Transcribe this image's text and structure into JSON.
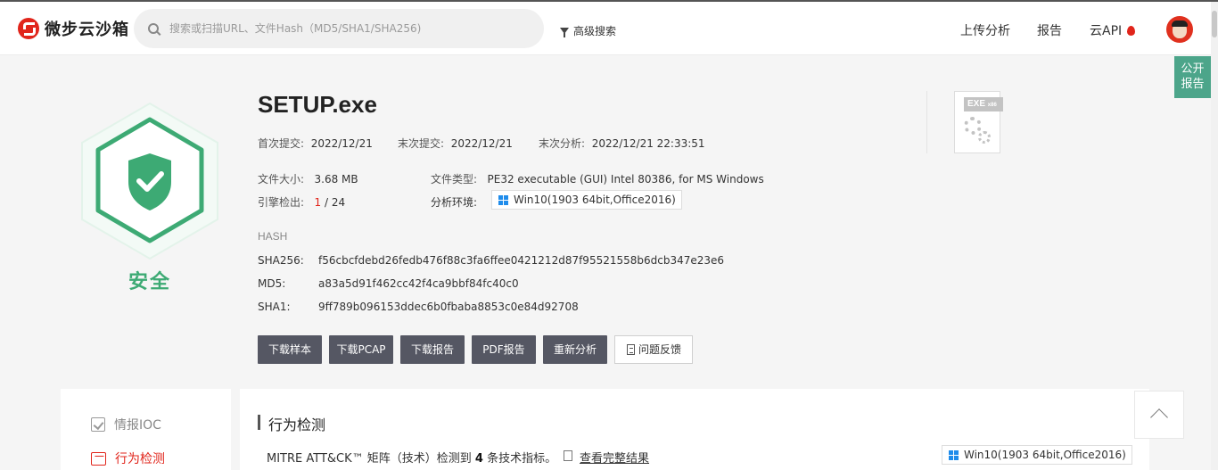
{
  "header": {
    "logo_text": "微步云沙箱",
    "search_placeholder": "搜索或扫描URL、文件Hash（MD5/SHA1/SHA256)",
    "advanced_search": "高级搜索",
    "nav_upload": "上传分析",
    "nav_report": "报告",
    "nav_api": "云API"
  },
  "side_tab": {
    "line1": "公开",
    "line2": "报告"
  },
  "verdict": {
    "label": "安全",
    "color": "#3daa74"
  },
  "file": {
    "name": "SETUP.exe",
    "first_submit_label": "首次提交:",
    "first_submit": "2022/12/21",
    "last_submit_label": "末次提交:",
    "last_submit": "2022/12/21",
    "last_analysis_label": "末次分析:",
    "last_analysis": "2022/12/21 22:33:51",
    "size_label": "文件大小:",
    "size": "3.68 MB",
    "type_label": "文件类型:",
    "type": "PE32 executable (GUI) Intel 80386, for MS Windows",
    "engine_label": "引擎检出:",
    "engine_hits": "1",
    "engine_total": "/ 24",
    "env_label": "分析环境:",
    "env": "Win10(1903 64bit,Office2016)",
    "icon_label": "EXE",
    "icon_sub": "x86"
  },
  "hash": {
    "heading": "HASH",
    "sha256_label": "SHA256:",
    "sha256": "f56cbcfdebd26fedb476f88c3fa6ffee0421212d87f95521558b6dcb347e23e6",
    "md5_label": "MD5:",
    "md5": "a83a5d91f462cc42f4ca9bbf84fc40c0",
    "sha1_label": "SHA1:",
    "sha1": "9ff789b096153ddec6b0fbaba8853c0e84d92708"
  },
  "actions": {
    "download_sample": "下载样本",
    "download_pcap": "下载PCAP",
    "download_report": "下载报告",
    "pdf_report": "PDF报告",
    "reanalyze": "重新分析",
    "feedback": "问题反馈"
  },
  "left_nav": {
    "ioc": "情报IOC",
    "behavior": "行为检测"
  },
  "behavior_section": {
    "title": "行为检测",
    "mitre_prefix": "MITRE ATT&CK™ 矩阵（技术）检测到",
    "mitre_count": "4",
    "mitre_suffix": "条技术指标。",
    "view_full": "查看完整结果",
    "env": "Win10(1903 64bit,Office2016)"
  },
  "colors": {
    "accent_red": "#e1251b",
    "button_dark": "#555763",
    "safe_green": "#3daa74",
    "public_tab": "#4ca58a"
  }
}
